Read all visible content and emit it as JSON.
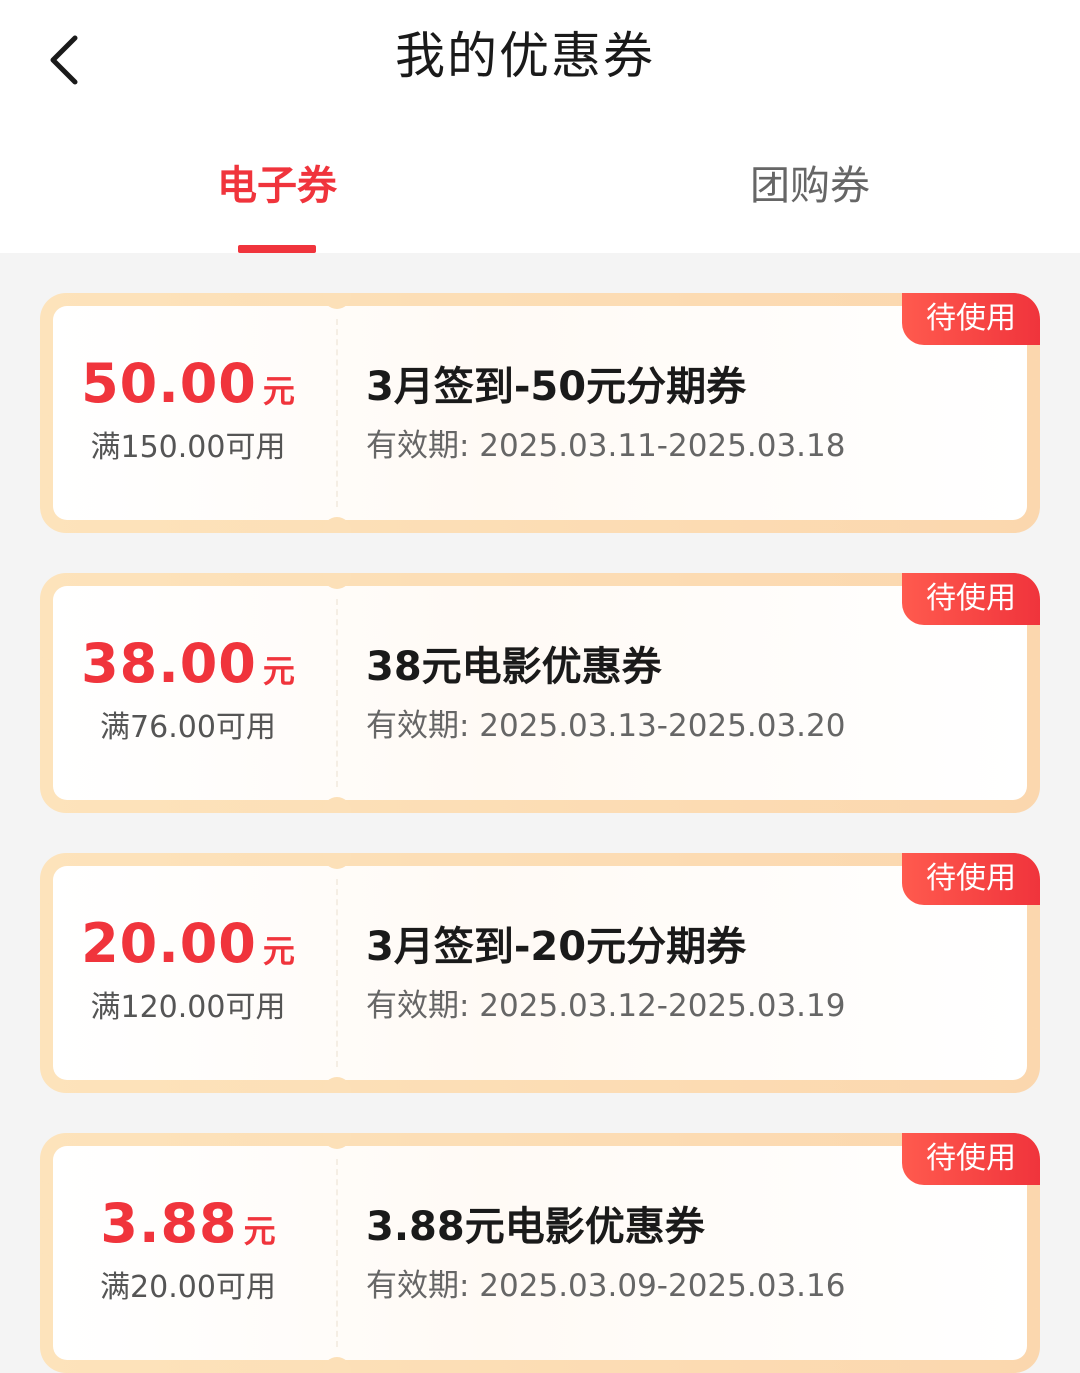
{
  "header": {
    "title": "我的优惠券",
    "back_icon": "chevron-left-icon"
  },
  "tabs": [
    {
      "label": "电子券",
      "active": true
    },
    {
      "label": "团购券",
      "active": false
    }
  ],
  "colors": {
    "accent": "#f0343c",
    "card_border": "#fde3bb"
  },
  "coupons": [
    {
      "amount": "50.00",
      "unit": "元",
      "condition": "满150.00可用",
      "title": "3月签到-50元分期券",
      "validity": "有效期: 2025.03.11-2025.03.18",
      "status": "待使用"
    },
    {
      "amount": "38.00",
      "unit": "元",
      "condition": "满76.00可用",
      "title": "38元电影优惠券",
      "validity": "有效期: 2025.03.13-2025.03.20",
      "status": "待使用"
    },
    {
      "amount": "20.00",
      "unit": "元",
      "condition": "满120.00可用",
      "title": "3月签到-20元分期券",
      "validity": "有效期: 2025.03.12-2025.03.19",
      "status": "待使用"
    },
    {
      "amount": "3.88",
      "unit": "元",
      "condition": "满20.00可用",
      "title": "3.88元电影优惠券",
      "validity": "有效期: 2025.03.09-2025.03.16",
      "status": "待使用"
    }
  ]
}
